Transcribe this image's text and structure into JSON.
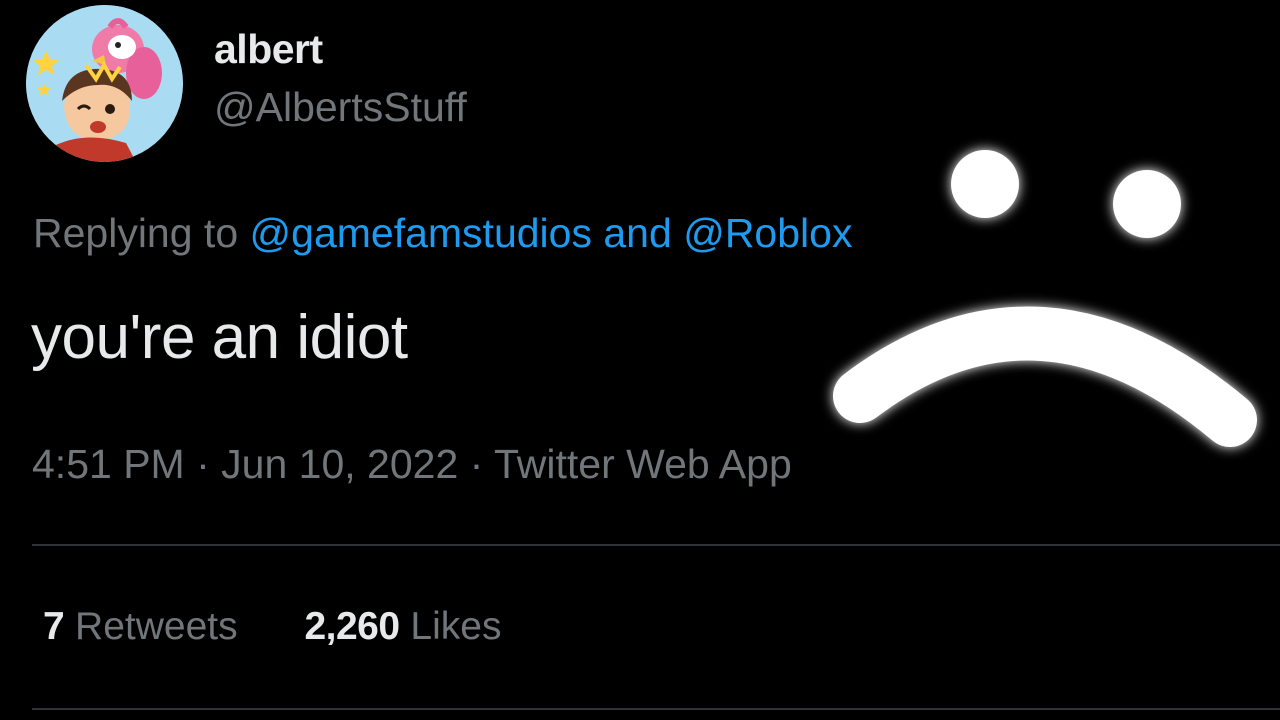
{
  "author": {
    "display_name": "albert",
    "handle": "@AlbertsStuff",
    "avatar_icon": "cartoon-avatar-icon"
  },
  "reply": {
    "prefix": "Replying to",
    "mention_1": "@gamefamstudios",
    "joiner": "and",
    "mention_2": "@Roblox"
  },
  "tweet": {
    "text": "you're an idiot"
  },
  "meta": {
    "time": "4:51 PM",
    "separator": "·",
    "date": "Jun 10, 2022",
    "source": "Twitter Web App"
  },
  "stats": {
    "retweets_count": "7",
    "retweets_label": "Retweets",
    "likes_count": "2,260",
    "likes_label": "Likes"
  },
  "overlay": {
    "icon": "sad-face-icon"
  },
  "colors": {
    "background": "#000000",
    "primary_text": "#e7e9ea",
    "secondary_text": "#71767b",
    "link": "#1d9bf0",
    "divider": "#2f3336"
  }
}
